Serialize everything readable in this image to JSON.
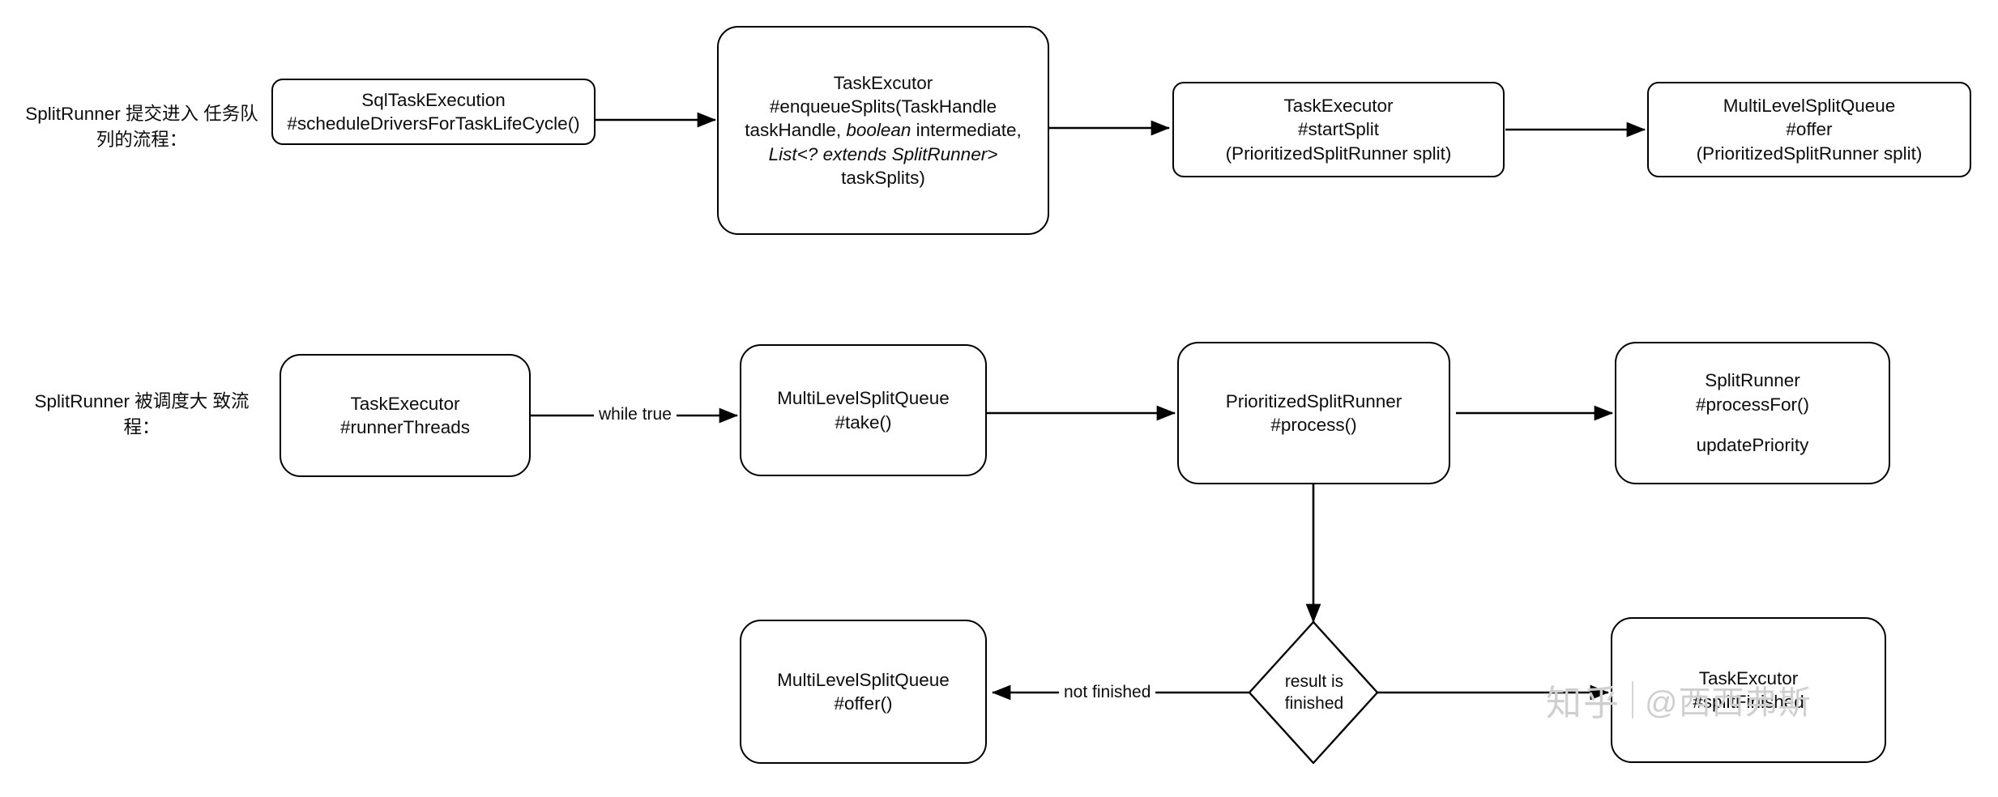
{
  "diagram": {
    "title_row1": "SplitRunner 提交进入\n任务队列的流程：",
    "row_labels": {
      "row1_line1": "SplitRunner 提交进入",
      "row1_line2": "任务队列的流程：",
      "row2_line1": "SplitRunner 被调度大",
      "row2_line2": "致流程："
    },
    "nodes": {
      "sql_task_execution": {
        "line1": "SqlTaskExecution",
        "line2": "#scheduleDriversForTaskLifeCycle()"
      },
      "task_executor_enqueue": {
        "line1": "TaskExcutor",
        "line2": "#enqueueSplits(TaskHandle",
        "line3a": "taskHandle, ",
        "line3b": "boolean",
        "line3c": " intermediate,",
        "line4": "List<? extends SplitRunner>",
        "line5": "taskSplits)"
      },
      "task_executor_start_split": {
        "line1": "TaskExecutor",
        "line2": "#startSplit",
        "line3": "(PrioritizedSplitRunner split)"
      },
      "multilevel_offer_top": {
        "line1": "MultiLevelSplitQueue",
        "line2": "#offer",
        "line3": "(PrioritizedSplitRunner split)"
      },
      "task_executor_runner_threads": {
        "line1": "TaskExecutor",
        "line2": "#runnerThreads"
      },
      "multilevel_take": {
        "line1": "MultiLevelSplitQueue",
        "line2": "#take()"
      },
      "prioritized_split_runner_process": {
        "line1": "PrioritizedSplitRunner",
        "line2": "#process()"
      },
      "split_runner_process_for": {
        "line1": "SplitRunner",
        "line2": "#processFor()",
        "line3": "updatePriority"
      },
      "multilevel_offer_bottom": {
        "line1": "MultiLevelSplitQueue",
        "line2": "#offer()"
      },
      "result_is_finished": {
        "line1": "result is",
        "line2": "finished"
      },
      "task_executor_split_finished": {
        "line1": "TaskExcutor",
        "line2": "#splitFinished"
      }
    },
    "edge_labels": {
      "while_true": "while true",
      "not_finished": "not finished"
    },
    "watermark": {
      "logo": "知乎",
      "user": "@西西弗斯"
    },
    "colors": {
      "stroke": "#000000",
      "background": "#ffffff",
      "text": "#0d0d0d",
      "watermark": "#cfcfcf"
    }
  }
}
